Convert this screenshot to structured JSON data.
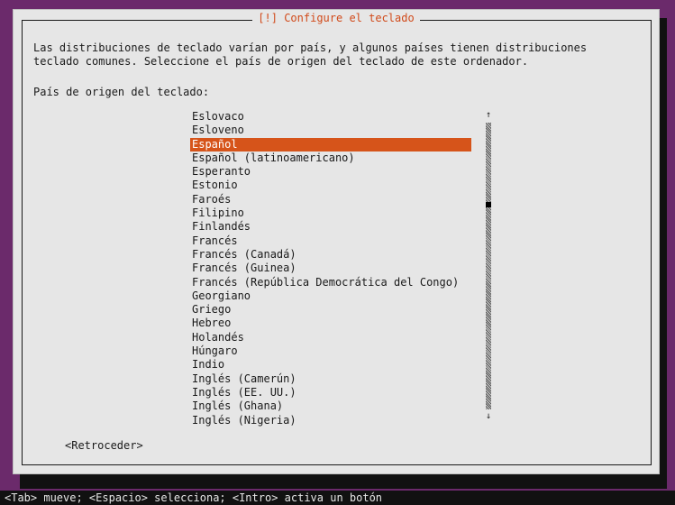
{
  "dialog": {
    "title": "[!] Configure el teclado",
    "description_line1": "Las distribuciones de teclado varían por país, y algunos países tienen distribuciones",
    "description_line2": "teclado comunes. Seleccione el país de origen del teclado de este ordenador.",
    "prompt": "País de origen del teclado:",
    "back_button": "<Retroceder>"
  },
  "list": {
    "items": [
      "Eslovaco",
      "Esloveno",
      "Español",
      "Español (latinoamericano)",
      "Esperanto",
      "Estonio",
      "Faroés",
      "Filipino",
      "Finlandés",
      "Francés",
      "Francés (Canadá)",
      "Francés (Guinea)",
      "Francés (República Democrática del Congo)",
      "Georgiano",
      "Griego",
      "Hebreo",
      "Holandés",
      "Húngaro",
      "Indio",
      "Inglés (Camerún)",
      "Inglés (EE. UU.)",
      "Inglés (Ghana)",
      "Inglés (Nigeria)"
    ],
    "selected": "Español"
  },
  "scrollbar": {
    "up_icon": "↑",
    "down_icon": "↓"
  },
  "statusbar": {
    "text": "<Tab> mueve; <Espacio> selecciona; <Intro> activa un botón"
  },
  "colors": {
    "background": "#6b2a6b",
    "dialog": "#e6e6e6",
    "selection": "#d6541a",
    "title": "#d14a1a"
  }
}
